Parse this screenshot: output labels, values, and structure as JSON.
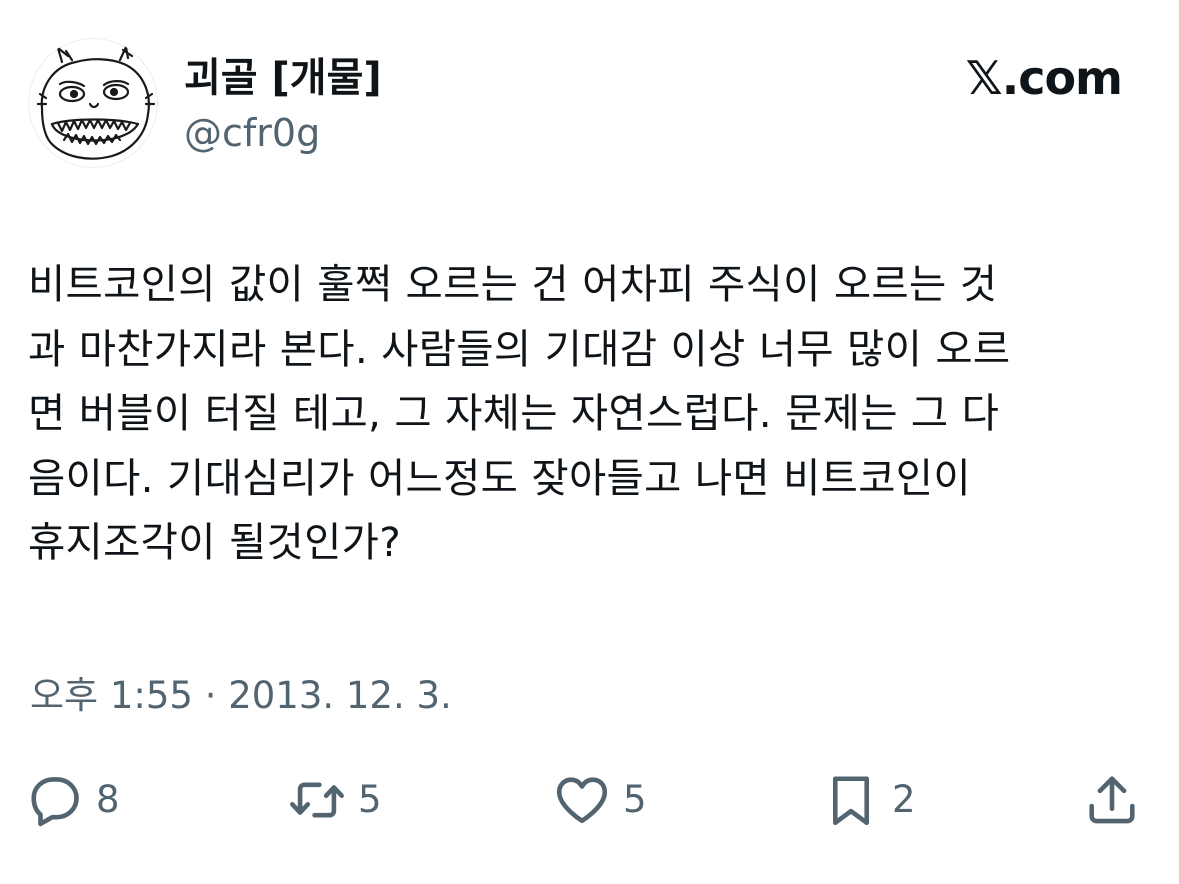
{
  "brand": {
    "label": "𝕏.com"
  },
  "author": {
    "display_name": "괴골 [개물]",
    "handle": "@cfr0g"
  },
  "tweet": {
    "text": "비트코인의 값이 훌쩍 오르는 건 어차피 주식이 오르는 것\n과 마찬가지라 본다. 사람들의 기대감 이상 너무 많이 오르\n면 버블이 터질 테고, 그 자체는 자연스럽다. 문제는 그 다\n음이다. 기대심리가 어느정도 잦아들고 나면 비트코인이\n휴지조각이 될것인가?",
    "timestamp": "오후 1:55 · 2013. 12. 3."
  },
  "actions": {
    "reply_count": "8",
    "retweet_count": "5",
    "like_count": "5",
    "bookmark_count": "2"
  },
  "icons": {
    "avatar": "monster-sketch-avatar",
    "reply": "speech-bubble-icon",
    "retweet": "retweet-arrows-icon",
    "like": "heart-icon",
    "bookmark": "bookmark-icon",
    "share": "share-upload-icon"
  }
}
